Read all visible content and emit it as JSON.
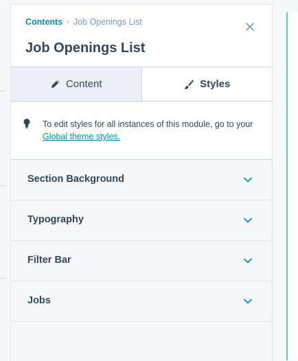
{
  "breadcrumb": {
    "parent": "Contents",
    "separator": "›",
    "current": "Job Openings List"
  },
  "header": {
    "title": "Job Openings List"
  },
  "tabs": [
    {
      "label": "Content",
      "icon": "pencil-icon",
      "active": false
    },
    {
      "label": "Styles",
      "icon": "brush-icon",
      "active": true
    }
  ],
  "notice": {
    "icon": "lightbulb-icon",
    "text": "To edit styles for all instances of this module, go to your",
    "link": "Global theme styles."
  },
  "sections": [
    {
      "label": "Section Background"
    },
    {
      "label": "Typography"
    },
    {
      "label": "Filter Bar"
    },
    {
      "label": "Jobs"
    }
  ],
  "colors": {
    "accent": "#0091ae",
    "text": "#33475b",
    "muted": "#7c98b6",
    "border": "#cbd6e2"
  }
}
